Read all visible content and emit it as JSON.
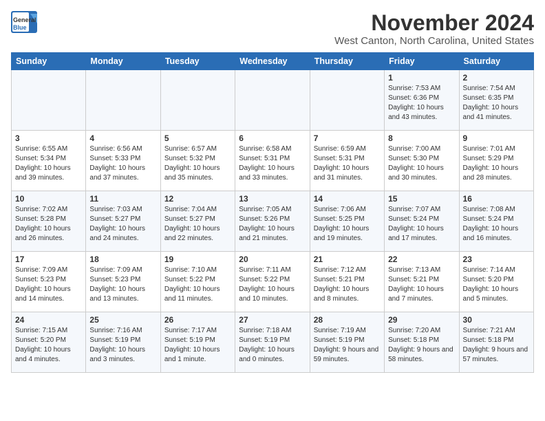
{
  "header": {
    "logo_line1": "General",
    "logo_line2": "Blue",
    "title": "November 2024",
    "subtitle": "West Canton, North Carolina, United States"
  },
  "days_of_week": [
    "Sunday",
    "Monday",
    "Tuesday",
    "Wednesday",
    "Thursday",
    "Friday",
    "Saturday"
  ],
  "weeks": [
    [
      {
        "day": "",
        "info": ""
      },
      {
        "day": "",
        "info": ""
      },
      {
        "day": "",
        "info": ""
      },
      {
        "day": "",
        "info": ""
      },
      {
        "day": "",
        "info": ""
      },
      {
        "day": "1",
        "info": "Sunrise: 7:53 AM\nSunset: 6:36 PM\nDaylight: 10 hours and 43 minutes."
      },
      {
        "day": "2",
        "info": "Sunrise: 7:54 AM\nSunset: 6:35 PM\nDaylight: 10 hours and 41 minutes."
      }
    ],
    [
      {
        "day": "3",
        "info": "Sunrise: 6:55 AM\nSunset: 5:34 PM\nDaylight: 10 hours and 39 minutes."
      },
      {
        "day": "4",
        "info": "Sunrise: 6:56 AM\nSunset: 5:33 PM\nDaylight: 10 hours and 37 minutes."
      },
      {
        "day": "5",
        "info": "Sunrise: 6:57 AM\nSunset: 5:32 PM\nDaylight: 10 hours and 35 minutes."
      },
      {
        "day": "6",
        "info": "Sunrise: 6:58 AM\nSunset: 5:31 PM\nDaylight: 10 hours and 33 minutes."
      },
      {
        "day": "7",
        "info": "Sunrise: 6:59 AM\nSunset: 5:31 PM\nDaylight: 10 hours and 31 minutes."
      },
      {
        "day": "8",
        "info": "Sunrise: 7:00 AM\nSunset: 5:30 PM\nDaylight: 10 hours and 30 minutes."
      },
      {
        "day": "9",
        "info": "Sunrise: 7:01 AM\nSunset: 5:29 PM\nDaylight: 10 hours and 28 minutes."
      }
    ],
    [
      {
        "day": "10",
        "info": "Sunrise: 7:02 AM\nSunset: 5:28 PM\nDaylight: 10 hours and 26 minutes."
      },
      {
        "day": "11",
        "info": "Sunrise: 7:03 AM\nSunset: 5:27 PM\nDaylight: 10 hours and 24 minutes."
      },
      {
        "day": "12",
        "info": "Sunrise: 7:04 AM\nSunset: 5:27 PM\nDaylight: 10 hours and 22 minutes."
      },
      {
        "day": "13",
        "info": "Sunrise: 7:05 AM\nSunset: 5:26 PM\nDaylight: 10 hours and 21 minutes."
      },
      {
        "day": "14",
        "info": "Sunrise: 7:06 AM\nSunset: 5:25 PM\nDaylight: 10 hours and 19 minutes."
      },
      {
        "day": "15",
        "info": "Sunrise: 7:07 AM\nSunset: 5:24 PM\nDaylight: 10 hours and 17 minutes."
      },
      {
        "day": "16",
        "info": "Sunrise: 7:08 AM\nSunset: 5:24 PM\nDaylight: 10 hours and 16 minutes."
      }
    ],
    [
      {
        "day": "17",
        "info": "Sunrise: 7:09 AM\nSunset: 5:23 PM\nDaylight: 10 hours and 14 minutes."
      },
      {
        "day": "18",
        "info": "Sunrise: 7:09 AM\nSunset: 5:23 PM\nDaylight: 10 hours and 13 minutes."
      },
      {
        "day": "19",
        "info": "Sunrise: 7:10 AM\nSunset: 5:22 PM\nDaylight: 10 hours and 11 minutes."
      },
      {
        "day": "20",
        "info": "Sunrise: 7:11 AM\nSunset: 5:22 PM\nDaylight: 10 hours and 10 minutes."
      },
      {
        "day": "21",
        "info": "Sunrise: 7:12 AM\nSunset: 5:21 PM\nDaylight: 10 hours and 8 minutes."
      },
      {
        "day": "22",
        "info": "Sunrise: 7:13 AM\nSunset: 5:21 PM\nDaylight: 10 hours and 7 minutes."
      },
      {
        "day": "23",
        "info": "Sunrise: 7:14 AM\nSunset: 5:20 PM\nDaylight: 10 hours and 5 minutes."
      }
    ],
    [
      {
        "day": "24",
        "info": "Sunrise: 7:15 AM\nSunset: 5:20 PM\nDaylight: 10 hours and 4 minutes."
      },
      {
        "day": "25",
        "info": "Sunrise: 7:16 AM\nSunset: 5:19 PM\nDaylight: 10 hours and 3 minutes."
      },
      {
        "day": "26",
        "info": "Sunrise: 7:17 AM\nSunset: 5:19 PM\nDaylight: 10 hours and 1 minute."
      },
      {
        "day": "27",
        "info": "Sunrise: 7:18 AM\nSunset: 5:19 PM\nDaylight: 10 hours and 0 minutes."
      },
      {
        "day": "28",
        "info": "Sunrise: 7:19 AM\nSunset: 5:19 PM\nDaylight: 9 hours and 59 minutes."
      },
      {
        "day": "29",
        "info": "Sunrise: 7:20 AM\nSunset: 5:18 PM\nDaylight: 9 hours and 58 minutes."
      },
      {
        "day": "30",
        "info": "Sunrise: 7:21 AM\nSunset: 5:18 PM\nDaylight: 9 hours and 57 minutes."
      }
    ]
  ]
}
